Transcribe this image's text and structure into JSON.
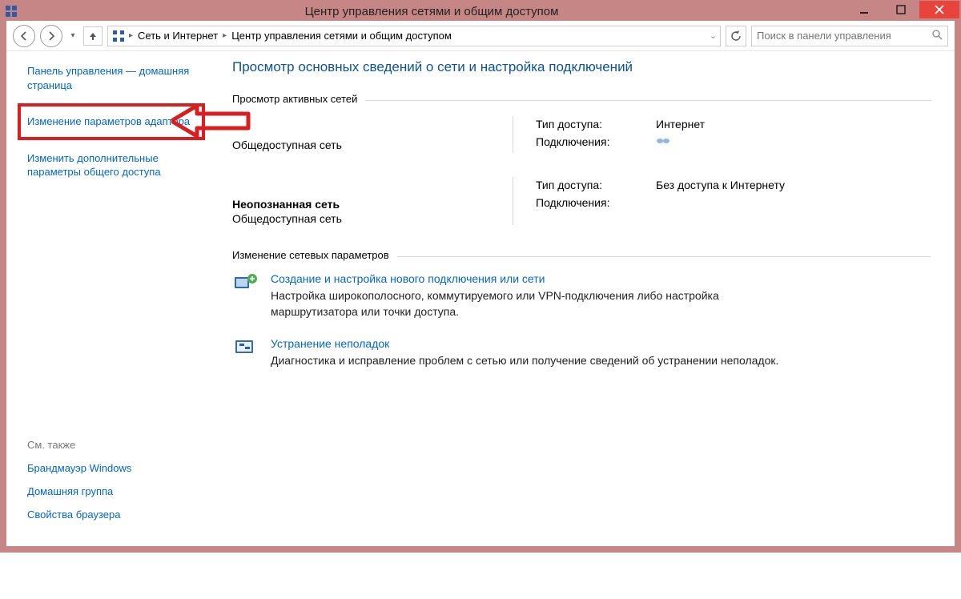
{
  "titlebar": {
    "title": "Центр управления сетями и общим доступом"
  },
  "breadcrumb": {
    "item1": "Сеть и Интернет",
    "item2": "Центр управления сетями и общим доступом"
  },
  "search": {
    "placeholder": "Поиск в панели управления"
  },
  "sidebar": {
    "home": "Панель управления — домашняя страница",
    "adapter": "Изменение параметров адаптера",
    "sharing": "Изменить дополнительные параметры общего доступа",
    "see_also_header": "См. также",
    "firewall": "Брандмауэр Windows",
    "homegroup": "Домашняя группа",
    "browser_props": "Свойства браузера"
  },
  "main": {
    "heading": "Просмотр основных сведений о сети и настройка подключений",
    "active_networks_label": "Просмотр активных сетей",
    "net1": {
      "type": "Общедоступная сеть",
      "access_label": "Тип доступа:",
      "access_value": "Интернет",
      "conn_label": "Подключения:"
    },
    "net2": {
      "name": "Неопознанная сеть",
      "type": "Общедоступная сеть",
      "access_label": "Тип доступа:",
      "access_value": "Без доступа к Интернету",
      "conn_label": "Подключения:"
    },
    "change_settings_label": "Изменение сетевых параметров",
    "action1": {
      "link": "Создание и настройка нового подключения или сети",
      "desc": "Настройка широкополосного, коммутируемого или VPN-подключения либо настройка маршрутизатора или точки доступа."
    },
    "action2": {
      "link": "Устранение неполадок",
      "desc": "Диагностика и исправление проблем с сетью или получение сведений об устранении неполадок."
    }
  }
}
